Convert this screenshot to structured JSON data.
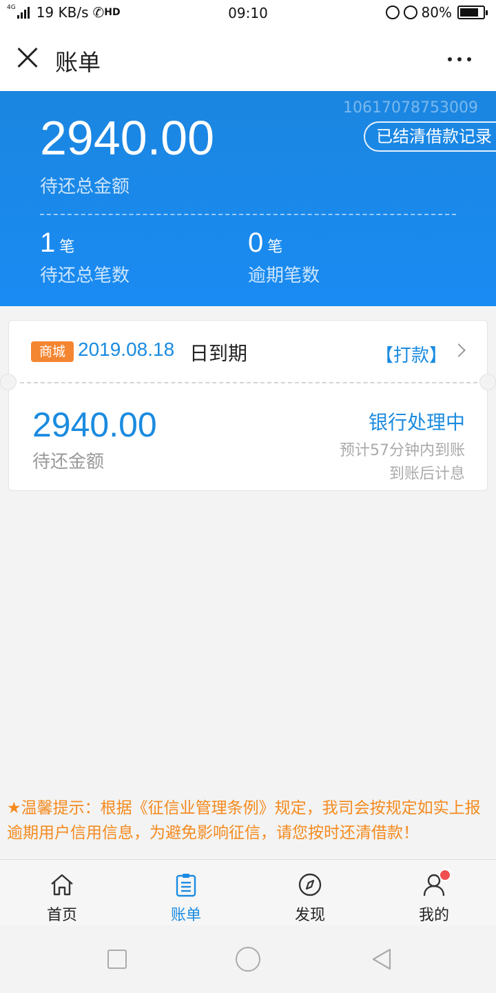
{
  "status_bar": {
    "network": "4G",
    "speed": "19 KB/s",
    "hd": "HD",
    "time": "09:10",
    "battery": "80%",
    "battery_level": 0.8
  },
  "nav": {
    "title": "账单"
  },
  "summary": {
    "account_number": "10617078753009",
    "total_amount": "2940.00",
    "total_label": "待还总金额",
    "history_button": "已结清借款记录",
    "pending_count": "1",
    "pending_unit": "笔",
    "pending_label": "待还总笔数",
    "overdue_count": "0",
    "overdue_unit": "笔",
    "overdue_label": "逾期笔数"
  },
  "bill": {
    "badge": "商城",
    "due_date": "2019.08.18",
    "due_suffix": "日到期",
    "pay_link": "【打款】",
    "amount": "2940.00",
    "amount_label": "待还金额",
    "status": "银行处理中",
    "eta": "预计57分钟内到账",
    "note": "到账后计息"
  },
  "tip": "★温馨提示：根据《征信业管理条例》规定，我司会按规定如实上报逾期用户信用信息，为避免影响征信，请您按时还清借款！",
  "tabs": [
    {
      "label": "首页",
      "icon": "home-icon",
      "active": false
    },
    {
      "label": "账单",
      "icon": "bill-icon",
      "active": true
    },
    {
      "label": "发现",
      "icon": "compass-icon",
      "active": false
    },
    {
      "label": "我的",
      "icon": "user-icon",
      "active": false
    }
  ],
  "colors": {
    "primary": "#1a8be0",
    "banner": "#1a8bf3",
    "badge": "#f48632",
    "tip": "#f48a1e",
    "notification": "#f05050"
  }
}
